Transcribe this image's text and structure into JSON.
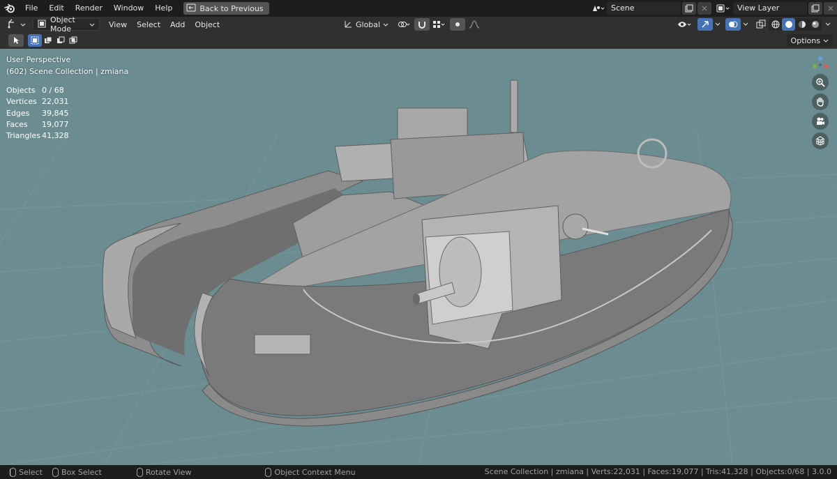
{
  "topbar": {
    "menus": [
      "File",
      "Edit",
      "Render",
      "Window",
      "Help"
    ],
    "back_label": "Back to Previous",
    "scene": "Scene",
    "view_layer": "View Layer"
  },
  "viewport_header": {
    "mode": "Object Mode",
    "menus": [
      "View",
      "Select",
      "Add",
      "Object"
    ],
    "orientation": "Global"
  },
  "toolbar": {
    "options_label": "Options"
  },
  "viewport": {
    "perspective": "User Perspective",
    "collection_info": "(602) Scene Collection | zmiana",
    "stats": [
      {
        "label": "Objects",
        "value": "0 / 68"
      },
      {
        "label": "Vertices",
        "value": "22,031"
      },
      {
        "label": "Edges",
        "value": "39,845"
      },
      {
        "label": "Faces",
        "value": "19,077"
      },
      {
        "label": "Triangles",
        "value": "41,328"
      }
    ],
    "background_color": "#6b8d91",
    "object_color": "#9a9a9a"
  },
  "statusbar": {
    "select": "Select",
    "box_select": "Box Select",
    "rotate_view": "Rotate View",
    "context_menu": "Object Context Menu",
    "info": "Scene Collection | zmiana | Verts:22,031 | Faces:19,077 | Tris:41,328 | Objects:0/68 | 3.0.0"
  },
  "colors": {
    "header_bg": "#1d1d1d",
    "panel_bg": "#303030",
    "accent": "#4772b3"
  }
}
